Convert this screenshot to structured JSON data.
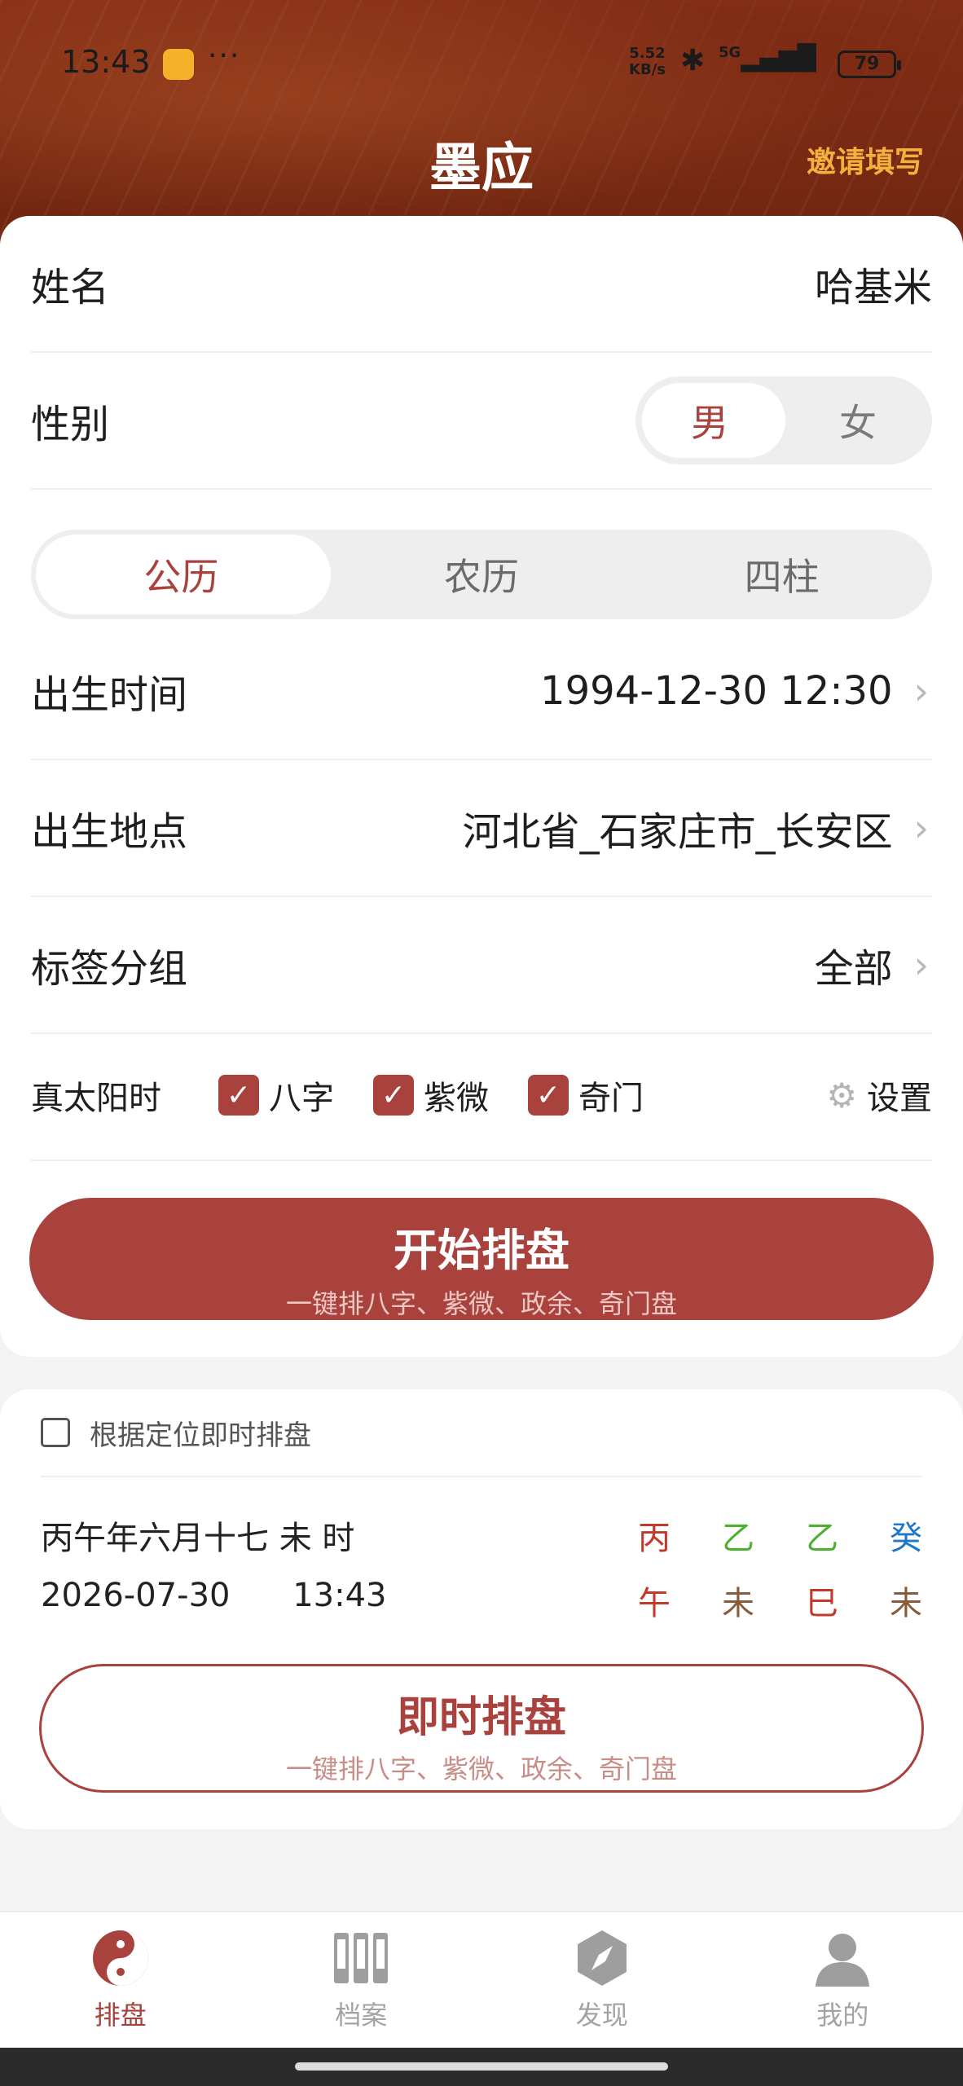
{
  "status_bar": {
    "time": "13:43",
    "more": "···",
    "net_speed_value": "5.52",
    "net_speed_unit": "KB/s",
    "signal_label": "5G",
    "battery": "79"
  },
  "header": {
    "title": "墨应",
    "invite": "邀请填写"
  },
  "form": {
    "name_label": "姓名",
    "name_value": "哈基米",
    "gender_label": "性别",
    "gender_options": [
      "男",
      "女"
    ],
    "gender_selected": "男",
    "calendar_tabs": [
      "公历",
      "农历",
      "四柱"
    ],
    "calendar_selected": "公历",
    "birth_time_label": "出生时间",
    "birth_time_value": "1994-12-30 12:30",
    "birth_place_label": "出生地点",
    "birth_place_value": "河北省_石家庄市_长安区",
    "tag_group_label": "标签分组",
    "tag_group_value": "全部",
    "solar_time_label": "真太阳时",
    "solar_options": [
      {
        "label": "八字",
        "checked": true
      },
      {
        "label": "紫微",
        "checked": true
      },
      {
        "label": "奇门",
        "checked": true
      }
    ],
    "settings_label": "设置",
    "start_button": "开始排盘",
    "start_button_sub": "一键排八字、紫微、政余、奇门盘"
  },
  "instant": {
    "location_checkbox_label": "根据定位即时排盘",
    "lunar_text": "丙午年六月十七 未 时",
    "date": "2026-07-30",
    "time": "13:43",
    "stems": [
      {
        "char": "丙",
        "color": "#c0392b"
      },
      {
        "char": "乙",
        "color": "#4caf2f"
      },
      {
        "char": "乙",
        "color": "#4caf2f"
      },
      {
        "char": "癸",
        "color": "#1f77c8"
      }
    ],
    "branches": [
      {
        "char": "午",
        "color": "#c0392b"
      },
      {
        "char": "未",
        "color": "#8a5a3a"
      },
      {
        "char": "巳",
        "color": "#c0392b"
      },
      {
        "char": "未",
        "color": "#8a5a3a"
      }
    ],
    "button": "即时排盘",
    "button_sub": "一键排八字、紫微、政余、奇门盘"
  },
  "tabbar": {
    "items": [
      {
        "label": "排盘",
        "icon": "yin-yang-icon",
        "active": true
      },
      {
        "label": "档案",
        "icon": "archive-icon",
        "active": false
      },
      {
        "label": "发现",
        "icon": "compass-icon",
        "active": false
      },
      {
        "label": "我的",
        "icon": "profile-icon",
        "active": false
      }
    ]
  },
  "colors": {
    "accent": "#a9413d",
    "header_bg": "#7a2a12",
    "invite": "#f3b03d"
  }
}
